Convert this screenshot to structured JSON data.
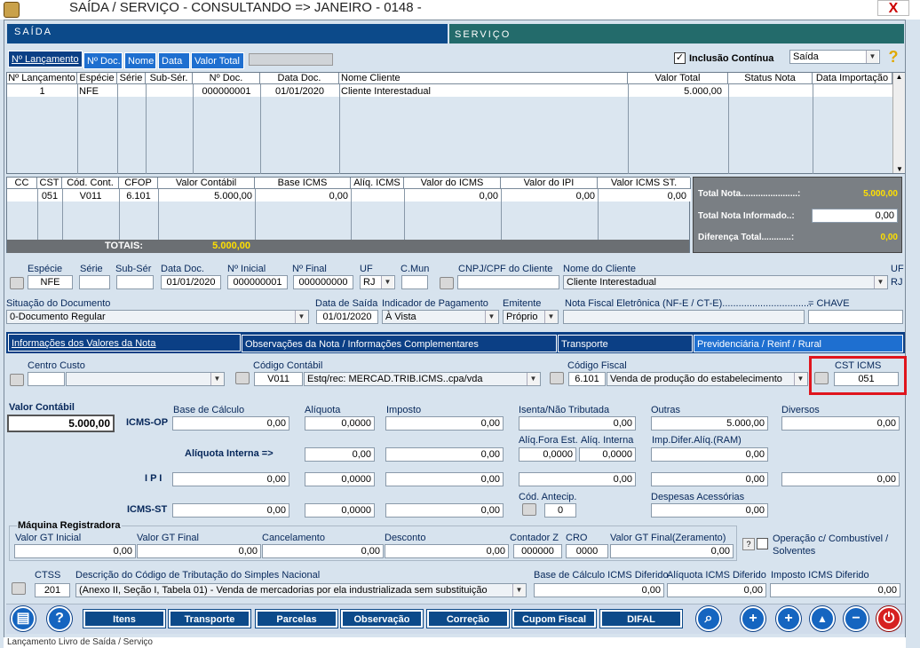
{
  "window": {
    "title": "SAÍDA / SERVIÇO  -  CONSULTANDO  =>  JANEIRO  -  0148 -",
    "close": "X"
  },
  "sections": {
    "saida": "SAÍDA",
    "servico": "SERVIÇO"
  },
  "sort_tabs": [
    "Nº Lançamento",
    "Nº Doc.",
    "Nome",
    "Data",
    "Valor Total"
  ],
  "inclusao": {
    "label": "Inclusão Contínua",
    "checked": true,
    "type_value": "Saída"
  },
  "notes_grid": {
    "headers": [
      "Nº Lançamento",
      "Espécie",
      "Série",
      "Sub-Sér.",
      "Nº Doc.",
      "Data Doc.",
      "Nome Cliente",
      "Valor Total",
      "Status Nota",
      "Data Importação"
    ],
    "row": [
      "1",
      "NFE",
      "",
      "",
      "000000001",
      "01/01/2020",
      "Cliente Interestadual",
      "5.000,00",
      "",
      ""
    ]
  },
  "items_grid": {
    "headers": [
      "CC",
      "CST",
      "Cód. Cont.",
      "CFOP",
      "Valor Contábil",
      "Base ICMS",
      "Alíq. ICMS",
      "Valor do ICMS",
      "Valor do IPI",
      "Valor ICMS ST."
    ],
    "row": [
      "",
      "051",
      "V011",
      "6.101",
      "5.000,00",
      "0,00",
      "",
      "0,00",
      "0,00",
      "0,00"
    ],
    "totals_label": "TOTAIS:",
    "totals_value": "5.000,00"
  },
  "totals": {
    "total_nota_label": "Total Nota.......................:",
    "total_nota": "5.000,00",
    "informado_label": "Total Nota Informado..:",
    "informado": "0,00",
    "diferenca_label": "Diferença Total............:",
    "diferenca": "0,00"
  },
  "header_fields": {
    "especie_l": "Espécie",
    "especie": "NFE",
    "serie_l": "Série",
    "serie": "",
    "subser_l": "Sub-Sér",
    "subser": "",
    "datadoc_l": "Data Doc.",
    "datadoc": "01/01/2020",
    "ninicial_l": "Nº Inicial",
    "ninicial": "000000001",
    "nfinal_l": "Nº Final",
    "nfinal": "000000000",
    "uf_l": "UF",
    "uf": "RJ",
    "cmun_l": "C.Mun",
    "cmun": "",
    "cnpj_l": "CNPJ/CPF do Cliente",
    "cnpj": "",
    "nome_l": "Nome do Cliente",
    "nome": "Cliente Interestadual",
    "uf2_l": "UF",
    "uf2": "RJ",
    "situacao_l": "Situação do Documento",
    "situacao": "0-Documento Regular",
    "datasaida_l": "Data de Saída",
    "datasaida": "01/01/2020",
    "indpag_l": "Indicador de Pagamento",
    "indpag": "À Vista",
    "emitente_l": "Emitente",
    "emitente": "Próprio",
    "nfe_l": "Nota Fiscal Eletrônica (NF-E / CT-E).................................",
    "nfe": "",
    "chave_l": "=  CHAVE",
    "chave": ""
  },
  "info_tabs": [
    "Informações dos Valores da Nota",
    "Observações da Nota / Informações Complementares",
    "Transporte",
    "Previdenciária / Reinf / Rural"
  ],
  "item_fields": {
    "cc_l": "Centro Custo",
    "cc": "",
    "cc_desc": "",
    "codcont_l": "Código Contábil",
    "codcont": "V011",
    "codcont_desc": "Estq/rec: MERCAD.TRIB.ICMS..cpa/vda",
    "codfis_l": "Código Fiscal",
    "codfis": "6.101",
    "codfis_desc": "Venda de produção do estabelecimento",
    "cst_l": "CST ICMS",
    "cst": "051"
  },
  "values": {
    "valor_contabil_l": "Valor Contábil",
    "valor_contabil": "5.000,00",
    "icmsop_l": "ICMS-OP",
    "base_l": "Base de Cálculo",
    "aliq_l": "Alíquota",
    "imposto_l": "Imposto",
    "isenta_l": "Isenta/Não Tributada",
    "outras_l": "Outras",
    "diversos_l": "Diversos",
    "base": "0,00",
    "aliq": "0,0000",
    "imposto": "0,00",
    "isenta": "0,00",
    "outras": "5.000,00",
    "diversos": "0,00",
    "aliq_interna_l": "Alíquota Interna =>",
    "aliq_int_base": "0,00",
    "aliq_int_aliq": "0,0000",
    "aliq_int_imp": "0,00",
    "aliq_fora_l": "Alíq.Fora Est.",
    "aliq_fora": "0,0000",
    "aliq_interna2_l": "Alíq. Interna",
    "aliq_interna2": "0,0000",
    "imp_difer_l": "Imp.Difer.Alíq.(RAM)",
    "imp_difer": "0,00",
    "ipi_l": "I P I",
    "ipi_base": "0,00",
    "ipi_aliq": "0,0000",
    "ipi_imp": "0,00",
    "ipi_isenta": "0,00",
    "ipi_outras": "0,00",
    "ipi_diversos": "0,00",
    "icmsst_l": "ICMS-ST",
    "st_base": "0,00",
    "st_aliq": "0,0000",
    "st_imp": "0,00",
    "antecip_l": "Cód. Antecip.",
    "antecip": "0",
    "desp_l": "Despesas Acessórias",
    "desp": "0,00"
  },
  "maquina": {
    "title": "Máquina Registradora",
    "gt_ini_l": "Valor GT Inicial",
    "gt_ini": "0,00",
    "gt_fin_l": "Valor GT Final",
    "gt_fin": "0,00",
    "canc_l": "Cancelamento",
    "canc": "0,00",
    "desc_l": "Desconto",
    "desc": "0,00",
    "contz_l": "Contador Z",
    "contz": "000000",
    "cro_l": "CRO",
    "cro": "0000",
    "gt_zer_l": "Valor GT Final(Zeramento)",
    "gt_zer": "0,00",
    "comb_l": "Operação c/ Combustível / Solventes"
  },
  "simples": {
    "ctss_l": "CTSS",
    "ctss": "201",
    "desc_l": "Descrição do Código de Tributação do Simples Nacional",
    "desc": "(Anexo II, Seção I, Tabela 01) - Venda de mercadorias por ela industrializada sem substituição",
    "base_dif_l": "Base de Cálculo ICMS Diferido",
    "base_dif": "0,00",
    "aliq_dif_l": "Alíquota ICMS Diferido",
    "aliq_dif": "0,00",
    "imp_dif_l": "Imposto ICMS Diferido",
    "imp_dif": "0,00"
  },
  "buttons": [
    "Itens",
    "Transporte",
    "Parcelas",
    "Observação",
    "Correção",
    "Cupom Fiscal",
    "DIFAL"
  ],
  "status": "Lançamento Livro de Saída / Serviço",
  "colors": {
    "highlight": "#e0151d",
    "navy": "#0c4a8a",
    "teal": "#236b6b"
  }
}
